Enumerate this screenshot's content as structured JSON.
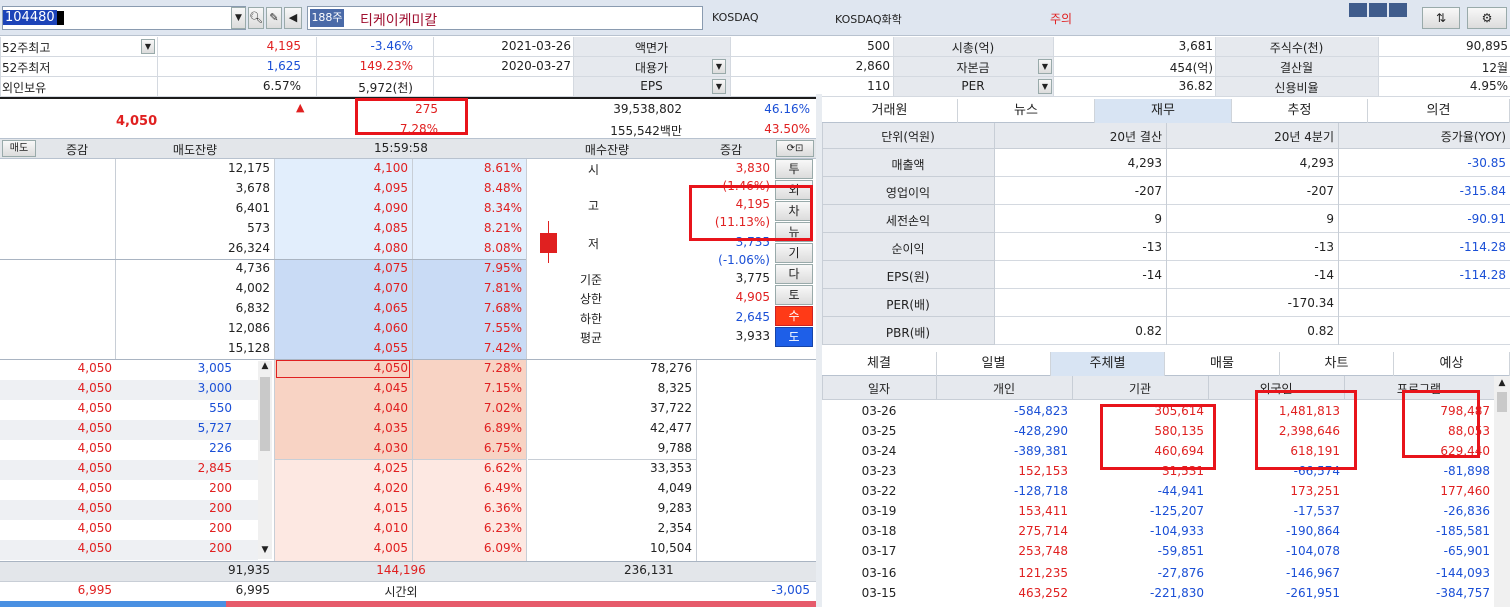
{
  "top": {
    "code": "104480",
    "name": "티케이케미칼",
    "market": "KOSDAQ",
    "sector": "KOSDAQ화학",
    "warning": "주의",
    "badge": "188주"
  },
  "info": {
    "rows": [
      {
        "label": "52주최고",
        "v1": "4,195",
        "v2": "-3.46%",
        "v3": "2021-03-26",
        "l2": "액면가",
        "v4": "500",
        "l3": "시총(억)",
        "v5": "3,681",
        "l4": "주식수(천)",
        "v6": "90,895"
      },
      {
        "label": "52주최저",
        "v1": "1,625",
        "v2": "149.23%",
        "v3": "2020-03-27",
        "l2": "대용가",
        "v4": "2,860",
        "l3": "자본금",
        "v5": "454(억)",
        "l4": "결산월",
        "v6": "12월"
      },
      {
        "label": "외인보유",
        "v1": "6.57%",
        "v2": "5,972(천)",
        "v3": "",
        "l2": "EPS",
        "v4": "110",
        "l3": "PER",
        "v5": "36.82",
        "l4": "신용비율",
        "v6": "4.95%"
      }
    ]
  },
  "quote": {
    "price": "4,050",
    "arrow": "▲",
    "change": "275",
    "change_pct": "7.28%",
    "volume": "39,538,802",
    "vol_pct": "46.16%",
    "amount": "155,542백만",
    "amt_pct": "43.50%"
  },
  "book_header": {
    "btn": "매도",
    "c1": "증감",
    "c2": "매도잔량",
    "c3": "15:59:58",
    "c4": "매수잔량",
    "c5": "증감"
  },
  "asks": [
    {
      "qty": "12,175",
      "price": "4,100",
      "pct": "8.61%"
    },
    {
      "qty": "3,678",
      "price": "4,095",
      "pct": "8.48%"
    },
    {
      "qty": "6,401",
      "price": "4,090",
      "pct": "8.34%"
    },
    {
      "qty": "573",
      "price": "4,085",
      "pct": "8.21%"
    },
    {
      "qty": "26,324",
      "price": "4,080",
      "pct": "8.08%"
    },
    {
      "qty": "4,736",
      "price": "4,075",
      "pct": "7.95%"
    },
    {
      "qty": "4,002",
      "price": "4,070",
      "pct": "7.81%"
    },
    {
      "qty": "6,832",
      "price": "4,065",
      "pct": "7.68%"
    },
    {
      "qty": "12,086",
      "price": "4,060",
      "pct": "7.55%"
    },
    {
      "qty": "15,128",
      "price": "4,055",
      "pct": "7.42%"
    }
  ],
  "bids": [
    {
      "tp": "4,050",
      "tq": "3,005",
      "price": "4,050",
      "pct": "7.28%",
      "qty": "78,276"
    },
    {
      "tp": "4,050",
      "tq": "3,000",
      "price": "4,045",
      "pct": "7.15%",
      "qty": "8,325"
    },
    {
      "tp": "4,050",
      "tq": "550",
      "price": "4,040",
      "pct": "7.02%",
      "qty": "37,722"
    },
    {
      "tp": "4,050",
      "tq": "5,727",
      "price": "4,035",
      "pct": "6.89%",
      "qty": "42,477"
    },
    {
      "tp": "4,050",
      "tq": "226",
      "price": "4,030",
      "pct": "6.75%",
      "qty": "9,788"
    },
    {
      "tp": "4,050",
      "tq": "2,845",
      "price": "4,025",
      "pct": "6.62%",
      "qty": "33,353"
    },
    {
      "tp": "4,050",
      "tq": "200",
      "price": "4,020",
      "pct": "6.49%",
      "qty": "4,049"
    },
    {
      "tp": "4,050",
      "tq": "200",
      "price": "4,015",
      "pct": "6.36%",
      "qty": "9,283"
    },
    {
      "tp": "4,050",
      "tq": "200",
      "price": "4,010",
      "pct": "6.23%",
      "qty": "2,354"
    },
    {
      "tp": "4,050",
      "tq": "200",
      "price": "4,005",
      "pct": "6.09%",
      "qty": "10,504"
    }
  ],
  "book_footer": {
    "ask_total": "91,935",
    "diff": "144,196",
    "bid_total": "236,131",
    "after_l": "6,995",
    "after_q": "6,995",
    "after_label": "시간외",
    "after_r": "-3,005"
  },
  "ohlc": {
    "open_l": "시",
    "open": "3,830",
    "open_pct": "(1.46%)",
    "high_l": "고",
    "high": "4,195",
    "high_pct": "(11.13%)",
    "low_l": "저",
    "low": "3,735",
    "low_pct": "(-1.06%)",
    "base_l": "기준",
    "base": "3,775",
    "upper_l": "상한",
    "upper": "4,905",
    "lower_l": "하한",
    "lower": "2,645",
    "avg_l": "평균",
    "avg": "3,933"
  },
  "side_buttons": [
    "투",
    "외",
    "차",
    "뉴",
    "기",
    "다",
    "토",
    "수",
    "도"
  ],
  "fin_tabs": [
    "거래원",
    "뉴스",
    "재무",
    "추정",
    "의견"
  ],
  "fin": {
    "headers": [
      "단위(억원)",
      "20년 결산",
      "20년 4분기",
      "증가율(YOY)"
    ],
    "rows": [
      {
        "label": "매출액",
        "a": "4,293",
        "b": "4,293",
        "c": "-30.85"
      },
      {
        "label": "영업이익",
        "a": "-207",
        "b": "-207",
        "c": "-315.84"
      },
      {
        "label": "세전손익",
        "a": "9",
        "b": "9",
        "c": "-90.91"
      },
      {
        "label": "순이익",
        "a": "-13",
        "b": "-13",
        "c": "-114.28"
      },
      {
        "label": "EPS(원)",
        "a": "-14",
        "b": "-14",
        "c": "-114.28"
      },
      {
        "label": "PER(배)",
        "a": "",
        "b": "-170.34",
        "c": ""
      },
      {
        "label": "PBR(배)",
        "a": "0.82",
        "b": "0.82",
        "c": ""
      }
    ]
  },
  "inv_tabs": [
    "체결",
    "일별",
    "주체별",
    "매물",
    "차트",
    "예상"
  ],
  "inv": {
    "headers": [
      "일자",
      "개인",
      "기관",
      "외국인",
      "프로그램"
    ],
    "rows": [
      {
        "d": "03-26",
        "p": "-584,823",
        "i": "305,614",
        "f": "1,481,813",
        "g": "798,487"
      },
      {
        "d": "03-25",
        "p": "-428,290",
        "i": "580,135",
        "f": "2,398,646",
        "g": "88,053"
      },
      {
        "d": "03-24",
        "p": "-389,381",
        "i": "460,694",
        "f": "618,191",
        "g": "629,440"
      },
      {
        "d": "03-23",
        "p": "152,153",
        "i": "31,531",
        "f": "-66,574",
        "g": "-81,898"
      },
      {
        "d": "03-22",
        "p": "-128,718",
        "i": "-44,941",
        "f": "173,251",
        "g": "177,460"
      },
      {
        "d": "03-19",
        "p": "153,411",
        "i": "-125,207",
        "f": "-17,537",
        "g": "-26,836"
      },
      {
        "d": "03-18",
        "p": "275,714",
        "i": "-104,933",
        "f": "-190,864",
        "g": "-185,581"
      },
      {
        "d": "03-17",
        "p": "253,748",
        "i": "-59,851",
        "f": "-104,078",
        "g": "-65,901"
      },
      {
        "d": "03-16",
        "p": "121,235",
        "i": "-27,876",
        "f": "-146,967",
        "g": "-144,093"
      },
      {
        "d": "03-15",
        "p": "463,252",
        "i": "-221,830",
        "f": "-261,951",
        "g": "-384,757"
      }
    ]
  },
  "colors": {
    "up": "#e02020",
    "down": "#1a4fd6",
    "highlight": "#e8141b"
  }
}
